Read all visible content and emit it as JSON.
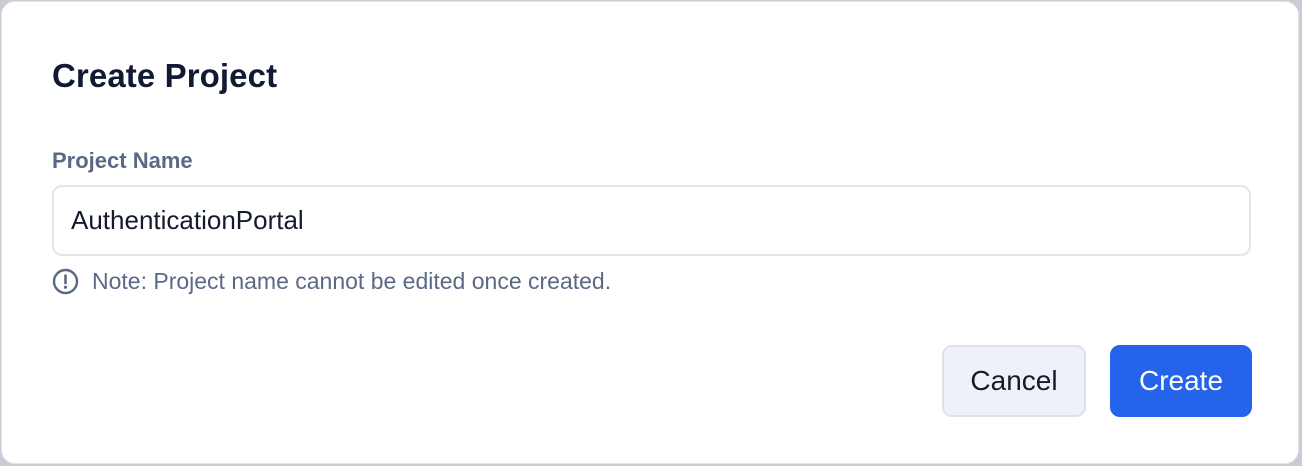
{
  "dialog": {
    "title": "Create Project",
    "field": {
      "label": "Project Name",
      "value": "AuthenticationPortal",
      "placeholder": ""
    },
    "note": {
      "icon": "info-circle-icon",
      "text": "Note: Project name cannot be edited once created."
    },
    "buttons": {
      "cancel_label": "Cancel",
      "create_label": "Create"
    }
  },
  "colors": {
    "primary": "#2563eb",
    "title": "#111a33",
    "muted": "#5a6a86",
    "input_border": "#e1e5ee",
    "secondary_button_bg": "#eff1f8"
  }
}
